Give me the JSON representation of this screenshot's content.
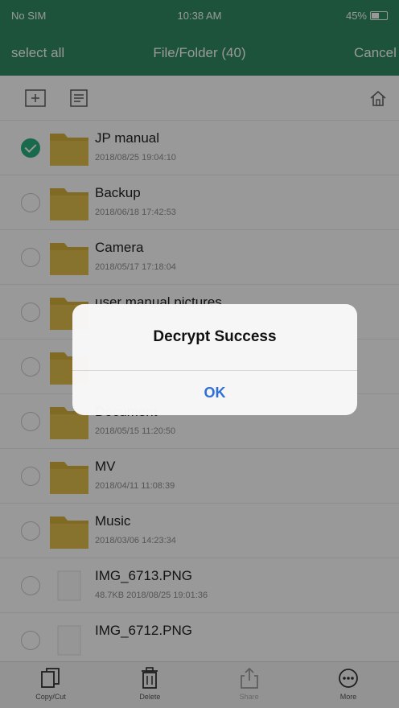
{
  "status_bar": {
    "carrier": "No SIM",
    "time": "10:38 AM",
    "battery": "45%"
  },
  "nav": {
    "select_all": "select all",
    "title": "File/Folder (40)",
    "cancel": "Cancel"
  },
  "toolbar": {
    "icons": [
      "new-folder-icon",
      "sort-icon",
      "home-icon"
    ]
  },
  "files": [
    {
      "name": "JP manual",
      "meta": "2018/08/25 19:04:10",
      "type": "folder",
      "checked": true
    },
    {
      "name": "Backup",
      "meta": "2018/06/18 17:42:53",
      "type": "folder",
      "checked": false
    },
    {
      "name": "Camera",
      "meta": "2018/05/17 17:18:04",
      "type": "folder",
      "checked": false
    },
    {
      "name": "user manual pictures",
      "meta": "",
      "type": "folder",
      "checked": false
    },
    {
      "name": "",
      "meta": "",
      "type": "folder",
      "checked": false
    },
    {
      "name": "Document",
      "meta": "2018/05/15 11:20:50",
      "type": "folder",
      "checked": false
    },
    {
      "name": "MV",
      "meta": "2018/04/11 11:08:39",
      "type": "folder",
      "checked": false
    },
    {
      "name": "Music",
      "meta": "2018/03/06 14:23:34",
      "type": "folder",
      "checked": false
    },
    {
      "name": "IMG_6713.PNG",
      "meta": "48.7KB 2018/08/25 19:01:36",
      "type": "file",
      "checked": false
    },
    {
      "name": "IMG_6712.PNG",
      "meta": "",
      "type": "file",
      "checked": false
    }
  ],
  "bottom_bar": [
    {
      "label": "Copy/Cut",
      "icon": "copy-icon",
      "disabled": false
    },
    {
      "label": "Delete",
      "icon": "trash-icon",
      "disabled": false
    },
    {
      "label": "Share",
      "icon": "share-icon",
      "disabled": true
    },
    {
      "label": "More",
      "icon": "more-icon",
      "disabled": false
    }
  ],
  "dialog": {
    "title": "Decrypt Success",
    "ok": "OK"
  },
  "colors": {
    "header": "#2f8a62",
    "check": "#2bb07f",
    "folder": "#d8b33c",
    "link": "#2f6fd6"
  }
}
